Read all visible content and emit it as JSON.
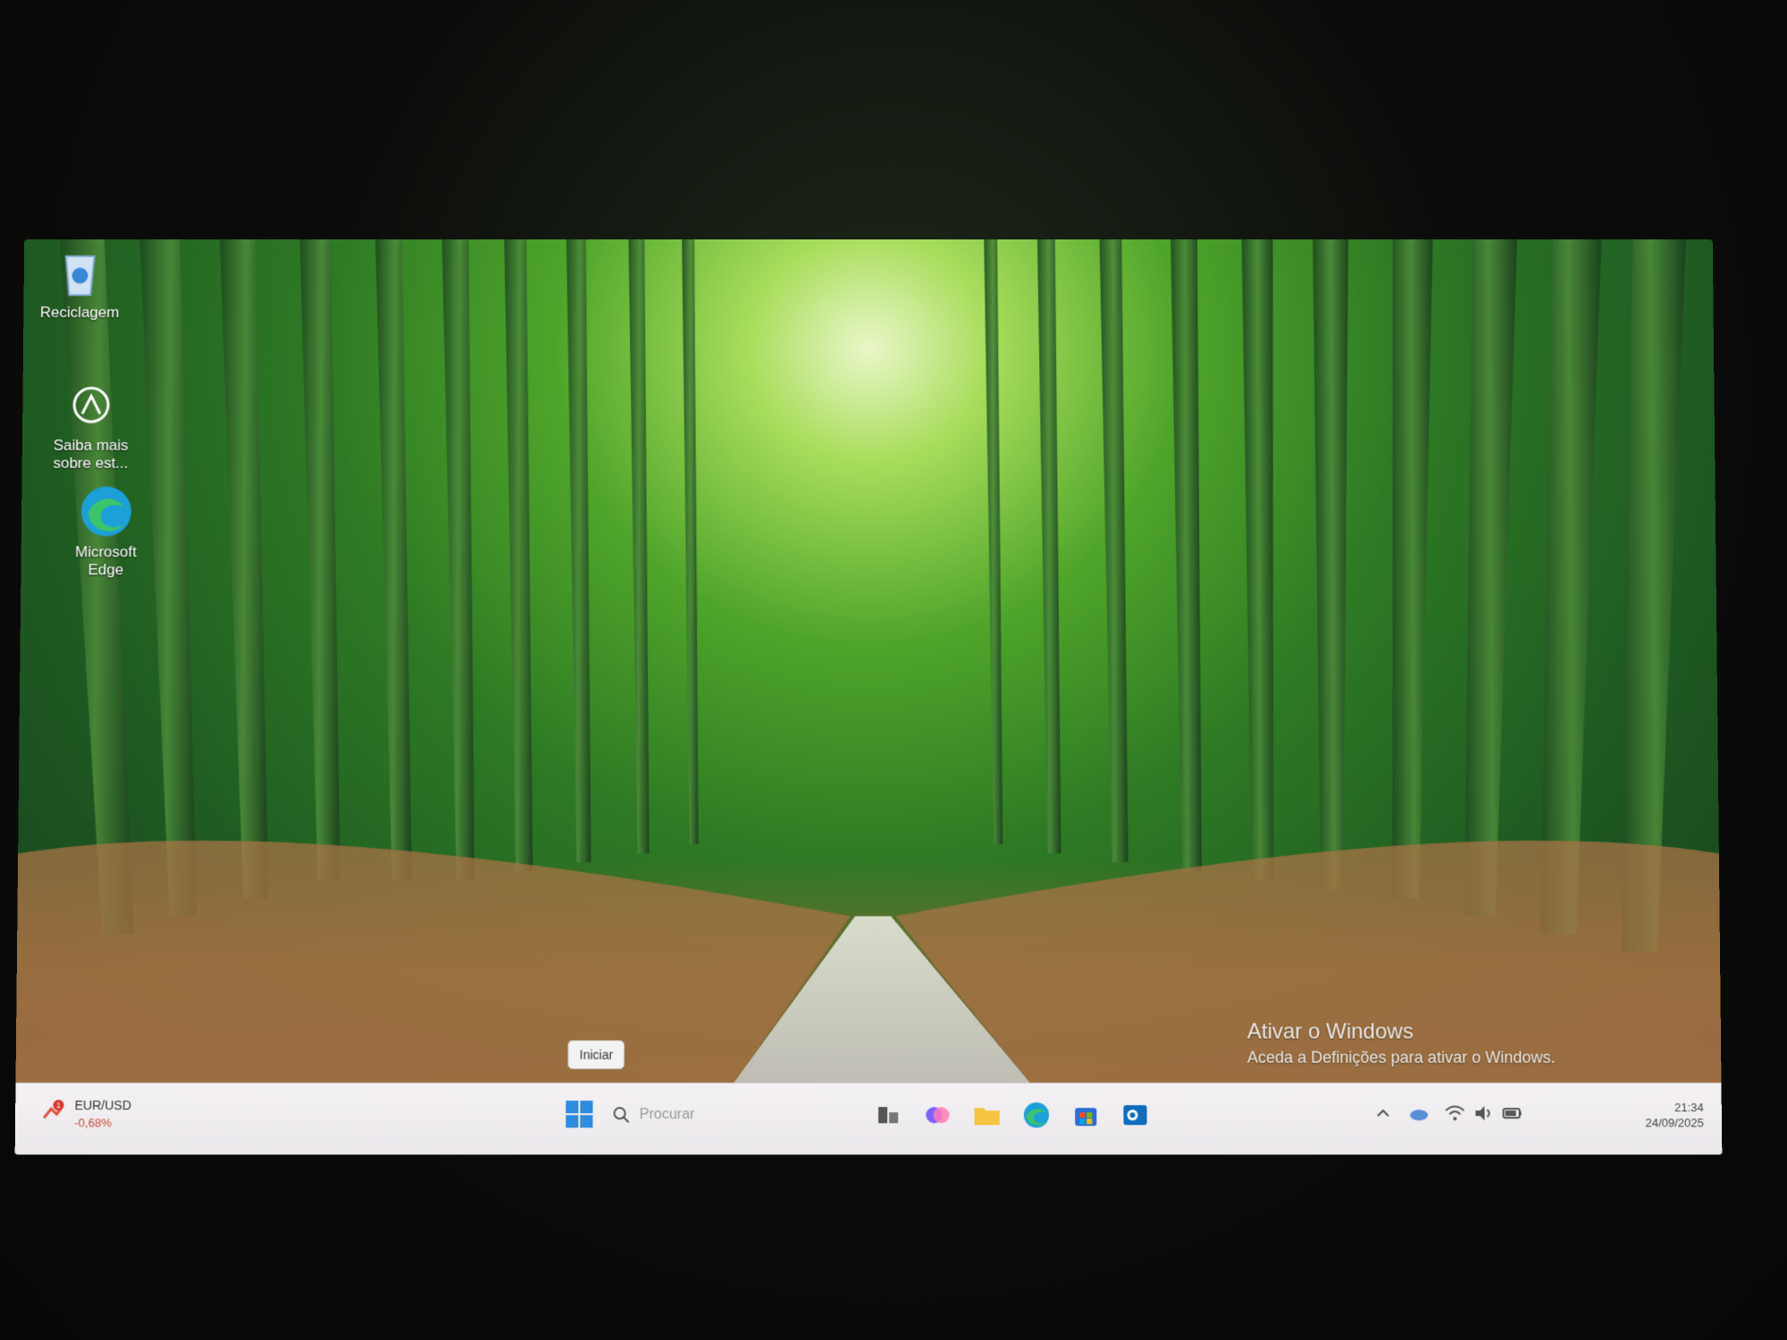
{
  "desktop": {
    "icons": [
      {
        "label": "Reciclagem",
        "icon": "recycle-bin-icon"
      },
      {
        "label": "Saiba mais sobre est...",
        "icon": "learn-more-icon"
      },
      {
        "label": "Microsoft Edge",
        "icon": "edge-icon"
      }
    ],
    "activation": {
      "title": "Ativar o Windows",
      "subtitle": "Aceda a Definições para ativar o Windows."
    },
    "tooltip": "Iniciar"
  },
  "taskbar": {
    "widget": {
      "badge": "1",
      "title": "EUR/USD",
      "value": "-0,68%"
    },
    "search_placeholder": "Procurar",
    "pinned_apps": [
      "task-view-icon",
      "copilot-icon",
      "file-explorer-icon",
      "edge-icon",
      "store-icon",
      "outlook-icon"
    ],
    "tray_icons": [
      "chevron-up-icon",
      "onedrive-icon",
      "wifi-icon",
      "volume-icon",
      "battery-icon"
    ],
    "clock": {
      "time": "21:34",
      "date": "24/09/2025"
    }
  },
  "colors": {
    "accent": "#0067c0",
    "taskbar": "#eeebef"
  }
}
